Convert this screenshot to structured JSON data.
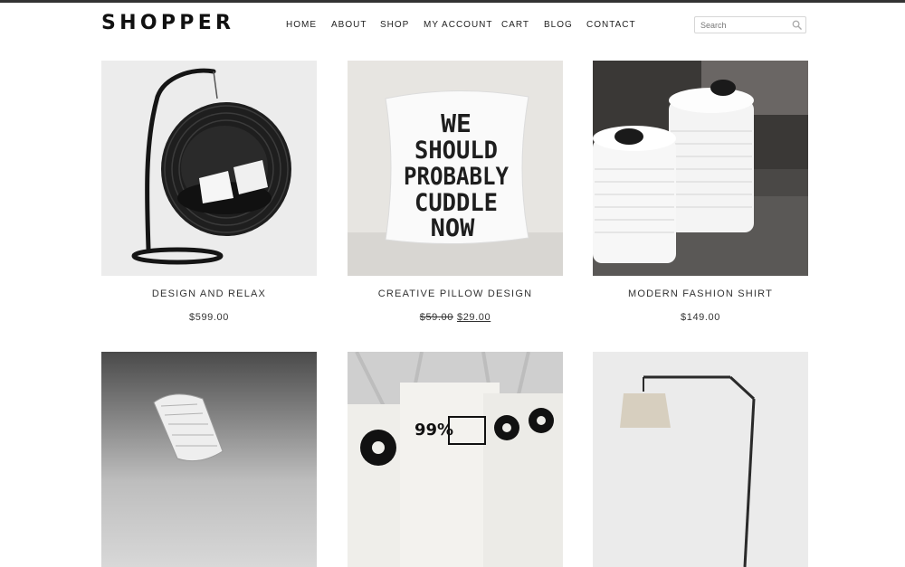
{
  "header": {
    "logo": "SHOPPER",
    "nav": [
      "HOME",
      "ABOUT",
      "SHOP",
      "MY ACCOUNT",
      "CART",
      "BLOG",
      "CONTACT"
    ],
    "search": {
      "placeholder": "Search",
      "icon": "search-icon"
    }
  },
  "products": [
    {
      "title": "DESIGN AND RELAX",
      "price": "$599.00",
      "image": "hanging-egg-chair"
    },
    {
      "title": "CREATIVE PILLOW DESIGN",
      "old_price": "$59.00",
      "price": "$29.00",
      "image": "pillow",
      "pillow_text": [
        "WE",
        "SHOULD",
        "PROBABLY",
        "CUDDLE",
        "NOW"
      ]
    },
    {
      "title": "MODERN FASHION SHIRT",
      "price": "$149.00",
      "image": "white-canisters"
    },
    {
      "image": "woven-bowl"
    },
    {
      "image": "tote-bags",
      "bag_text": "99%"
    },
    {
      "image": "arc-floor-lamp"
    }
  ]
}
